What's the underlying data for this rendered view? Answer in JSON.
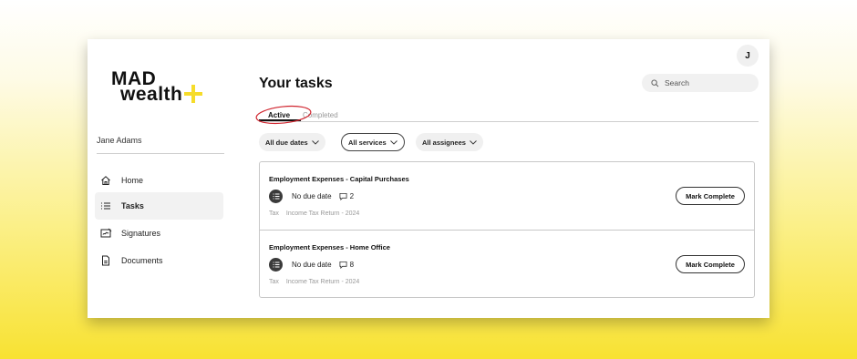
{
  "brand": {
    "line1": "MAD",
    "line2": "wealth",
    "plus_color": "#f6dc2a"
  },
  "user": {
    "name": "Jane Adams",
    "avatar_initial": "J"
  },
  "nav": [
    {
      "label": "Home",
      "icon": "home-icon",
      "active": false
    },
    {
      "label": "Tasks",
      "icon": "list-icon",
      "active": true
    },
    {
      "label": "Signatures",
      "icon": "signature-icon",
      "active": false
    },
    {
      "label": "Documents",
      "icon": "document-icon",
      "active": false
    }
  ],
  "page": {
    "title": "Your tasks"
  },
  "search": {
    "placeholder": "Search",
    "value": ""
  },
  "tabs": [
    {
      "label": "Active",
      "active": true
    },
    {
      "label": "Completed",
      "active": false
    }
  ],
  "filters": [
    {
      "label": "All due dates"
    },
    {
      "label": "All services"
    },
    {
      "label": "All assignees"
    }
  ],
  "tasks": [
    {
      "title": "Employment Expenses - Capital Purchases",
      "due": "No due date",
      "comments": "2",
      "category": "Tax",
      "service": "Income Tax Return - 2024",
      "action": "Mark Complete"
    },
    {
      "title": "Employment Expenses - Home Office",
      "due": "No due date",
      "comments": "8",
      "category": "Tax",
      "service": "Income Tax Return - 2024",
      "action": "Mark Complete"
    }
  ],
  "colors": {
    "annotation": "#d0252f",
    "accent": "#f6dc2a"
  }
}
